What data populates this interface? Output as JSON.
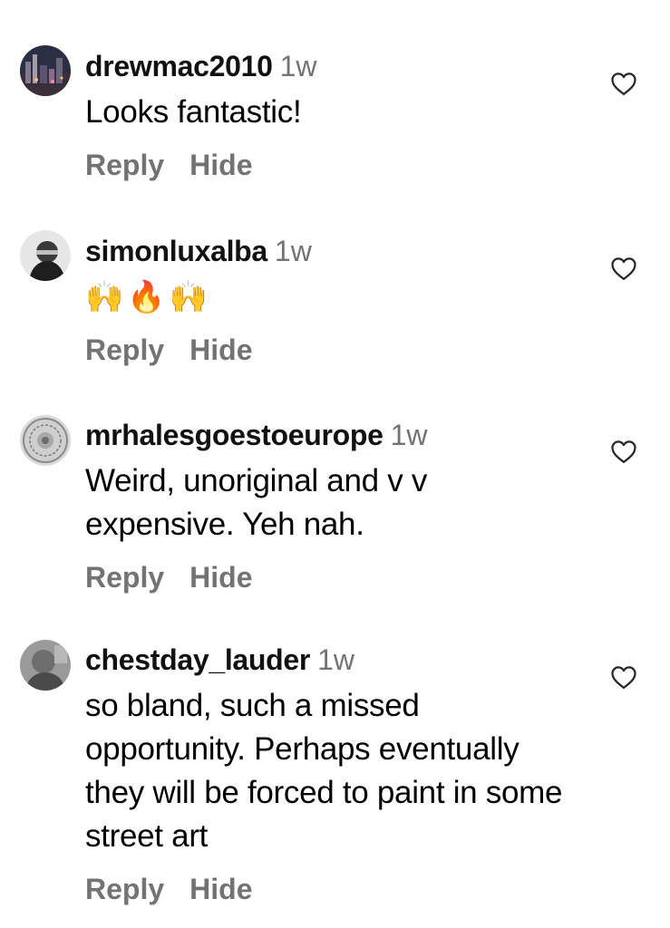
{
  "comments": [
    {
      "username": "drewmac2010",
      "time": "1w",
      "text": "Looks fantastic!",
      "reply_label": "Reply",
      "hide_label": "Hide",
      "avatar_icon": "city-night-photo"
    },
    {
      "username": "simonluxalba",
      "time": "1w",
      "text": "🙌🔥🙌",
      "reply_label": "Reply",
      "hide_label": "Hide",
      "avatar_icon": "bw-portrait-photo"
    },
    {
      "username": "mrhalesgoestoeurope",
      "time": "1w",
      "text": "Weird, unoriginal and v v expensive. Yeh nah.",
      "reply_label": "Reply",
      "hide_label": "Hide",
      "avatar_icon": "ornate-seal-photo"
    },
    {
      "username": "chestday_lauder",
      "time": "1w",
      "text": "so bland, such a missed opportunity. Perhaps eventually they will be forced to paint in some street art",
      "reply_label": "Reply",
      "hide_label": "Hide",
      "avatar_icon": "grey-portrait-photo"
    }
  ],
  "colors": {
    "secondary_text": "#737373",
    "primary_text": "#000000",
    "background": "#ffffff"
  },
  "icons": {
    "like": "heart-outline-icon"
  }
}
